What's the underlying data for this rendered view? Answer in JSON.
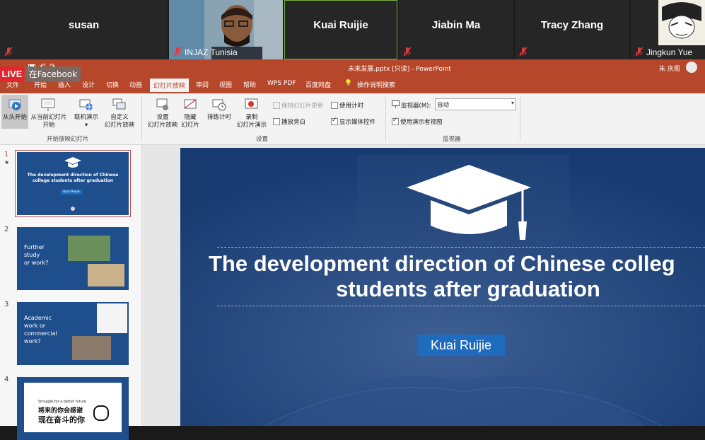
{
  "participants": [
    {
      "name": "susan",
      "muted": true
    },
    {
      "name": "INJAZ Tunisia",
      "muted": true
    },
    {
      "name": "Kuai Ruijie",
      "muted": false
    },
    {
      "name": "Jiabin Ma",
      "muted": true
    },
    {
      "name": "Tracy Zhang",
      "muted": true
    },
    {
      "name": "Jingkun Yue",
      "muted": true
    }
  ],
  "stream": {
    "live_label": "LIVE",
    "platform_label": "在Facebook"
  },
  "window": {
    "title": "未来发展.pptx [只读] - PowerPoint",
    "user": "朱 庆阁"
  },
  "tabs": [
    "文件",
    "开始",
    "插入",
    "设计",
    "切换",
    "动画",
    "幻灯片放映",
    "审阅",
    "视图",
    "帮助",
    "WPS PDF",
    "百度网盘",
    "操作说明搜索"
  ],
  "active_tab": "幻灯片放映",
  "ribbon": {
    "start_group": {
      "label": "开始放映幻灯片",
      "from_beginning": "从头开始",
      "from_current": [
        "从当前幻灯片",
        "开始"
      ],
      "online": [
        "联机演示"
      ],
      "custom": [
        "自定义",
        "幻灯片放映"
      ]
    },
    "setup_group": {
      "label": "设置",
      "setup_show": [
        "设置",
        "幻灯片放映"
      ],
      "hide_slide": [
        "隐藏",
        "幻灯片"
      ],
      "rehearse": "排练计时",
      "record": [
        "录制",
        "幻灯片演示"
      ],
      "keep_updated": "保持幻灯片更新",
      "play_narrations": "播放旁白",
      "use_timings": "使用计时",
      "show_media_controls": "显示媒体控件"
    },
    "monitor_group": {
      "label": "监视器",
      "monitor_label": "监视器(M):",
      "monitor_value": "自动",
      "presenter_view": "使用演示者视图"
    }
  },
  "slides": [
    {
      "num": "1",
      "title": "The development direction of Chinese college students after graduation",
      "author": "Kuai Ruijie"
    },
    {
      "num": "2",
      "text": [
        "Further",
        "study",
        "or work?"
      ]
    },
    {
      "num": "3",
      "text": [
        "Academic",
        "work or",
        "commercial",
        "work?"
      ]
    },
    {
      "num": "4",
      "text": [
        "Struggle for a better future",
        "将来的你会感谢",
        "现在奋斗的你"
      ]
    }
  ],
  "main_slide": {
    "title_line1": "The development direction of Chinese colleg",
    "title_line2": "students after graduation",
    "author": "Kuai Ruijie"
  }
}
